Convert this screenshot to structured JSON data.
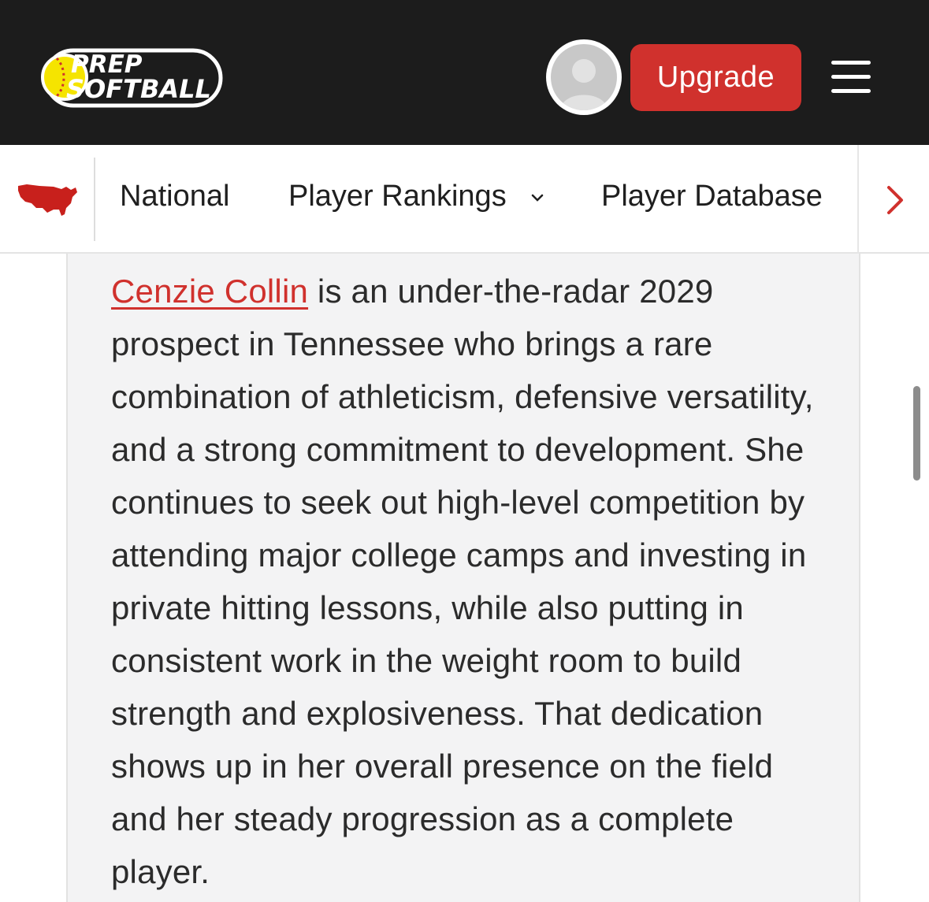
{
  "header": {
    "logo_text": [
      "PREP",
      "SOFTBALL"
    ],
    "upgrade_label": "Upgrade",
    "colors": {
      "bar": "#1c1c1c",
      "accent": "#d0312d",
      "ball": "#f5e400"
    }
  },
  "nav": {
    "items": [
      {
        "label": "National"
      },
      {
        "label": "Player Rankings",
        "has_dropdown": true
      },
      {
        "label": "Player Database"
      }
    ],
    "region_icon": "usa-map-icon",
    "more_icon": "chevron-right-icon"
  },
  "article": {
    "player_name": "Cenzie Collin",
    "body": " is an under-the-radar 2029 prospect in Tennessee who brings a rare combination of athleticism, defensive versatility, and a strong commitment to development. She continues to seek out high-level competition by attending major college camps and investing in private hitting lessons, while also putting in consistent work in the weight room to build strength and explosiveness. That dedication shows up in her overall presence on the field and her steady progression as a complete player."
  }
}
